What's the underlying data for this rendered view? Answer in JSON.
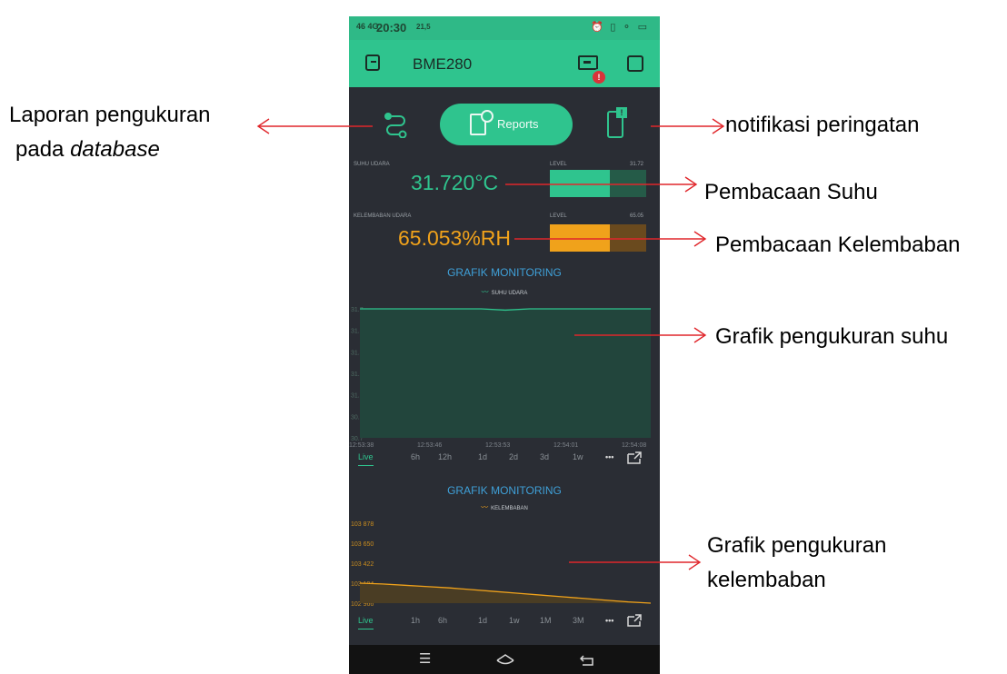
{
  "status_bar": {
    "signal": "46 4G",
    "time": "20:30",
    "speed": "21,5",
    "icons": "⏰ ▯ ⚬ ▭"
  },
  "app_bar": {
    "title": "BME280",
    "badge": "!"
  },
  "controls": {
    "reports_label": "Reports"
  },
  "temp_widget": {
    "label": "SUHU UDARA",
    "value": "31.720°C",
    "level_label": "LEVEL",
    "level_value": "31.72",
    "level_fraction": 0.62,
    "color": "#2fc48e"
  },
  "hum_widget": {
    "label": "KELEMBABAN UDARA",
    "value": "65.053%RH",
    "level_label": "LEVEL",
    "level_value": "65.05",
    "level_fraction": 0.62,
    "color": "#f0a21b"
  },
  "chart1": {
    "title": "GRAFIK MONITORING",
    "legend": "SUHU UDARA",
    "tabs": [
      "Live",
      "6h",
      "12h",
      "1d",
      "2d",
      "3d",
      "1w",
      "•••"
    ],
    "active_tab": "Live"
  },
  "chart2": {
    "title": "GRAFIK MONITORING",
    "legend": "KELEMBABAN",
    "tabs": [
      "Live",
      "1h",
      "6h",
      "1d",
      "1w",
      "1M",
      "3M",
      "•••"
    ],
    "active_tab": "Live"
  },
  "chart_data": [
    {
      "type": "area",
      "title": "GRAFIK MONITORING",
      "series": [
        {
          "name": "SUHU UDARA",
          "color": "#2fc48e",
          "values": [
            31.7,
            31.7,
            31.7,
            31.7,
            31.7,
            31.7,
            31.69,
            31.7,
            31.7,
            31.7,
            31.7,
            31.7,
            31.7
          ]
        }
      ],
      "ylim": [
        30.7,
        31.7
      ],
      "y_ticks": [
        "31.7",
        "31.6",
        "31.4",
        "31.2",
        "31.0",
        "30.9",
        "30.7"
      ],
      "x_ticks": [
        "12:53:38",
        "12:53:46",
        "12:53:53",
        "12:54:01",
        "12:54:08"
      ]
    },
    {
      "type": "area",
      "title": "GRAFIK MONITORING",
      "series": [
        {
          "name": "KELEMBABAN",
          "color": "#f0a21b",
          "values": [
            103194,
            103185,
            103170,
            103155,
            103140,
            103120,
            103100,
            103080,
            103060,
            103040,
            103020,
            103000,
            102980,
            102966
          ]
        }
      ],
      "ylim": [
        102966,
        103878
      ],
      "y_ticks": [
        "103 878",
        "103 650",
        "103 422",
        "103 194",
        "102 966"
      ]
    }
  ],
  "annotations": {
    "reports": [
      "Laporan pengukuran",
      "pada database"
    ],
    "notification": "notifikasi peringatan",
    "temp": "Pembacaan Suhu",
    "humidity": "Pembacaan Kelembaban",
    "temp_chart": "Grafik pengukuran suhu",
    "hum_chart": [
      "Grafik pengukuran",
      "kelembaban"
    ]
  }
}
